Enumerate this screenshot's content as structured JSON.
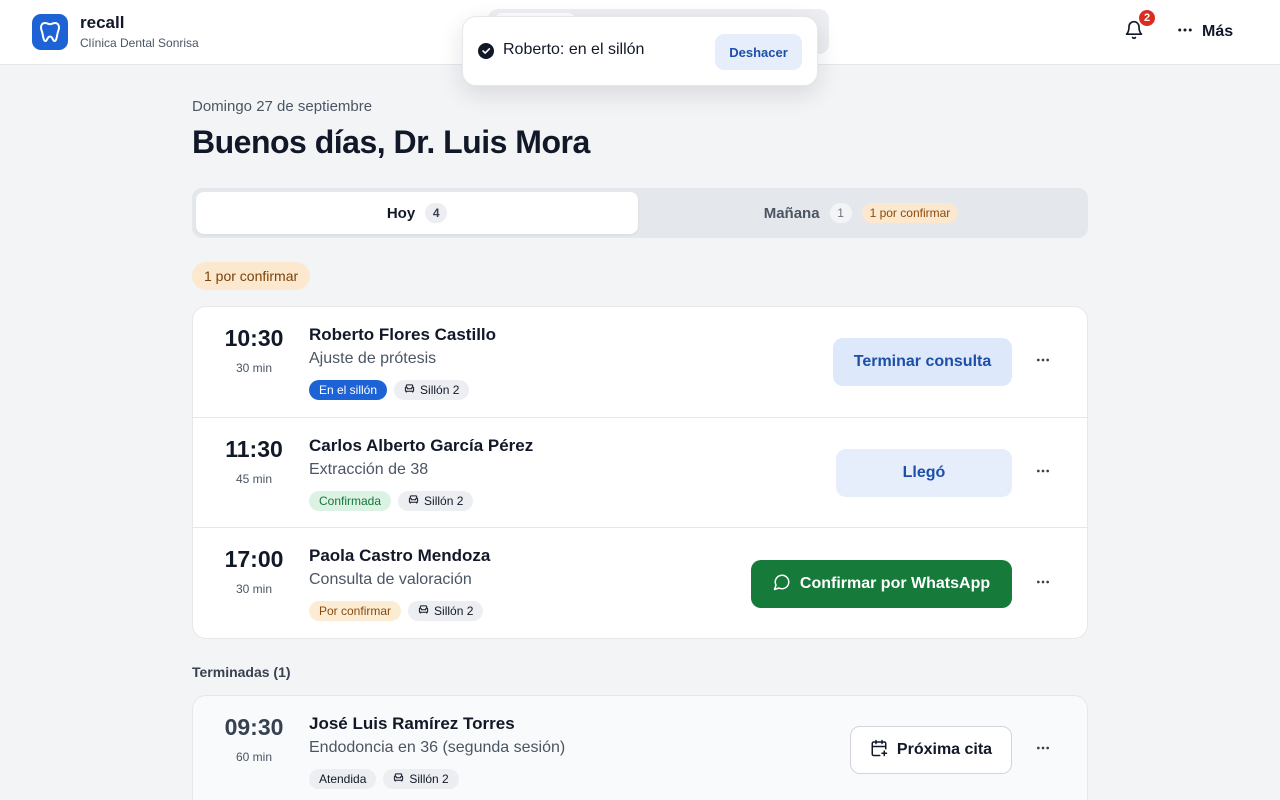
{
  "header": {
    "app_name": "recall",
    "clinic_name": "Clínica Dental Sonrisa",
    "notifications_count": "2",
    "more_label": "Más"
  },
  "toast": {
    "message": "Roberto: en el sillón",
    "undo_label": "Deshacer"
  },
  "greeting": {
    "date": "Domingo 27 de septiembre",
    "title": "Buenos días, Dr. Luis Mora"
  },
  "tabs": [
    {
      "label": "Hoy",
      "count": "4"
    },
    {
      "label": "Mañana",
      "count": "1",
      "pending": "1 por confirmar"
    }
  ],
  "section_pending_label": "1 por confirmar",
  "appointments": [
    {
      "time": "10:30",
      "duration": "30 min",
      "patient": "Roberto Flores Castillo",
      "procedure": "Ajuste de prótesis",
      "status": "En el sillón",
      "chair": "Sillón 2",
      "action": "Terminar consulta"
    },
    {
      "time": "11:30",
      "duration": "45 min",
      "patient": "Carlos Alberto García Pérez",
      "procedure": "Extracción de 38",
      "status": "Confirmada",
      "chair": "Sillón 2",
      "action": "Llegó"
    },
    {
      "time": "17:00",
      "duration": "30 min",
      "patient": "Paola Castro Mendoza",
      "procedure": "Consulta de valoración",
      "status": "Por confirmar",
      "chair": "Sillón 2",
      "action": "Confirmar por WhatsApp"
    }
  ],
  "finished": {
    "heading": "Terminadas (1)",
    "items": [
      {
        "time": "09:30",
        "duration": "60 min",
        "patient": "José Luis Ramírez Torres",
        "procedure": "Endodoncia en 36 (segunda sesión)",
        "status": "Atendida",
        "chair": "Sillón 2",
        "action": "Próxima cita"
      }
    ]
  },
  "colors": {
    "primary": "#1d63d6",
    "whatsapp": "#157a3a",
    "pending": "#fbe8cf",
    "confirmed": "#dcf3e4",
    "alert": "#d92d20"
  },
  "icons": [
    "tooth-icon",
    "bell-icon",
    "more-horizontal-icon",
    "check-circle-icon",
    "armchair-icon",
    "whatsapp-icon",
    "calendar-plus-icon"
  ]
}
